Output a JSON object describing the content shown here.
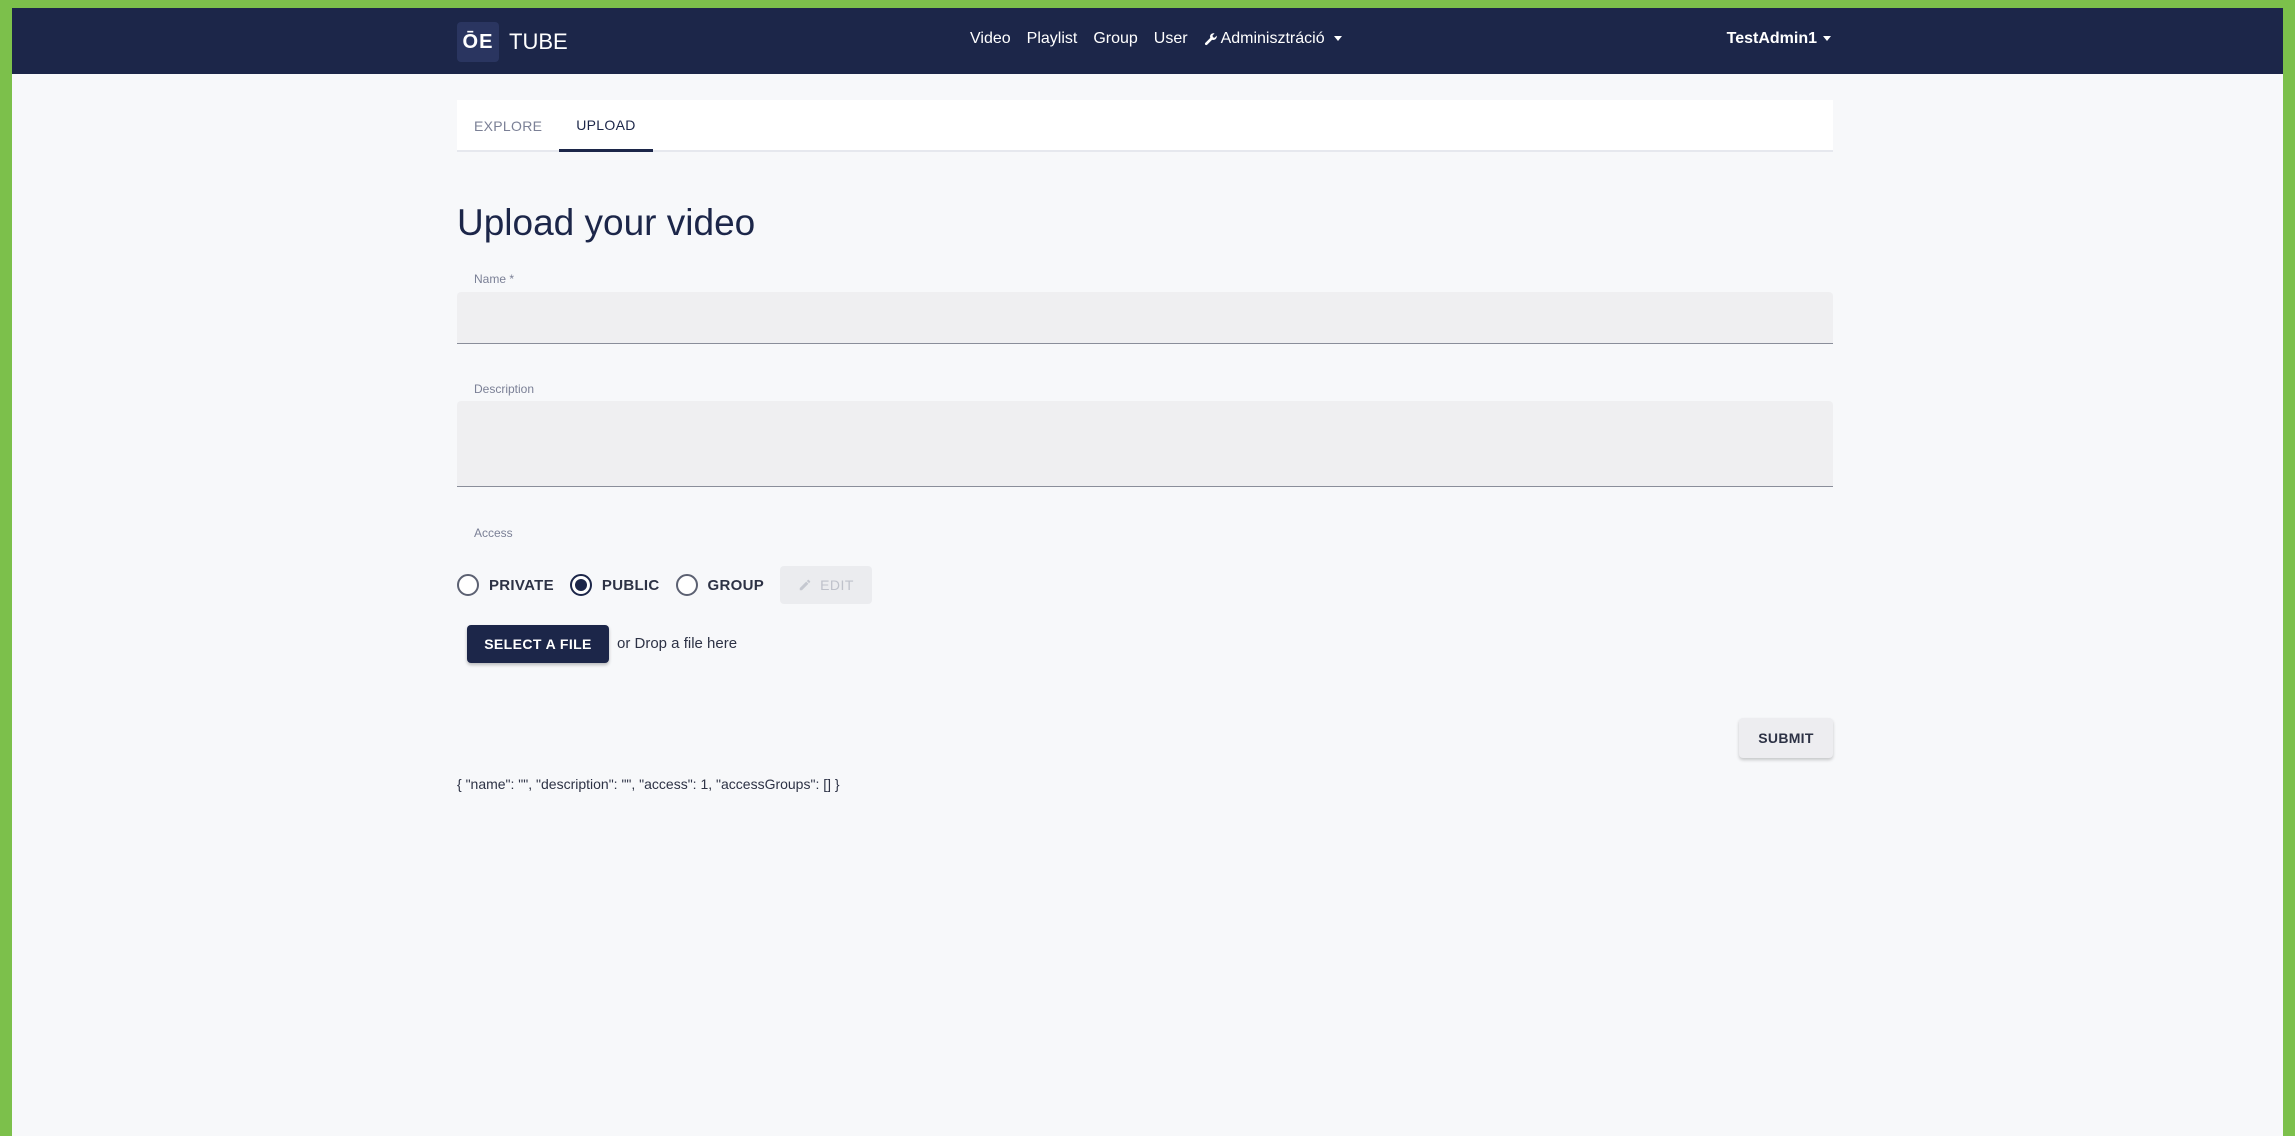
{
  "navbar": {
    "logo_text": "ŌE",
    "brand": "TUBE",
    "links": [
      "Video",
      "Playlist",
      "Group",
      "User"
    ],
    "admin_label": "Adminisztráció",
    "user_label": "TestAdmin1"
  },
  "tabs": [
    {
      "label": "EXPLORE",
      "active": false
    },
    {
      "label": "UPLOAD",
      "active": true
    }
  ],
  "form": {
    "title": "Upload your video",
    "name_label": "Name *",
    "name_value": "",
    "description_label": "Description",
    "description_value": "",
    "access_label": "Access",
    "access_options": [
      {
        "label": "PRIVATE",
        "checked": false
      },
      {
        "label": "PUBLIC",
        "checked": true
      },
      {
        "label": "GROUP",
        "checked": false
      }
    ],
    "edit_label": "EDIT",
    "select_file_label": "SELECT A FILE",
    "drop_text": "or Drop a file here",
    "submit_label": "SUBMIT",
    "json_preview": "{ \"name\": \"\", \"description\": \"\", \"access\": 1, \"accessGroups\": [] }"
  },
  "colors": {
    "navbar": "#1c2649",
    "accent": "#1c2649",
    "border": "#7cc04b",
    "background": "#f7f8fa"
  }
}
